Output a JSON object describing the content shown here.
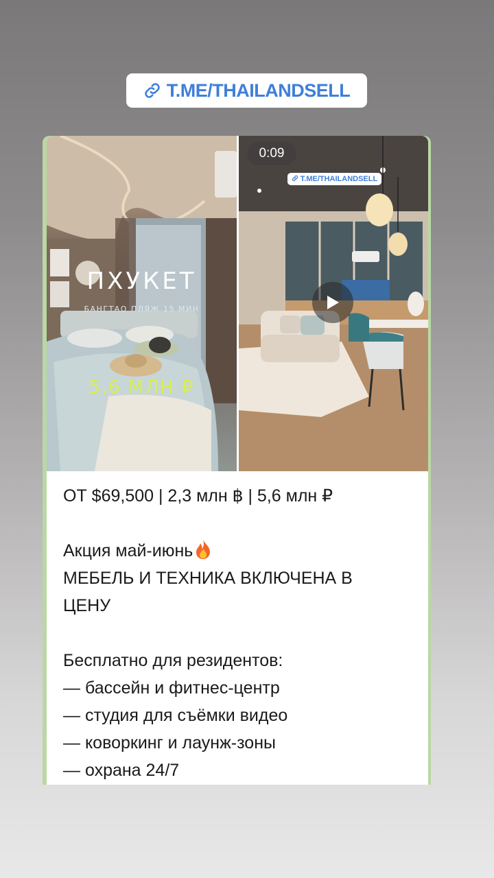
{
  "link_pill": {
    "text": "T.ME/THAILANDSELL",
    "color": "#3f7fd9",
    "icon": "link-icon"
  },
  "media": {
    "left_image": {
      "title": "ПХУКЕТ",
      "subtitle": "БАНГТАО ПЛЯЖ 15 МИН",
      "price": "5,6 МЛН ₽"
    },
    "right_video": {
      "duration": "0:09",
      "watermark": "T.ME/THAILANDSELL",
      "play_icon": "play-icon"
    }
  },
  "message": {
    "price_line": "ОТ $69,500 | 2,3 млн ฿ | 5,6 млн ₽",
    "promo": "Акция май-июнь",
    "promo_emoji": "fire-emoji",
    "furniture_line1": "МЕБЕЛЬ И ТЕХНИКА ВКЛЮЧЕНА В",
    "furniture_line2": "ЦЕНУ",
    "free_heading": "Бесплатно для резидентов:",
    "items": [
      "— бассейн и фитнес-центр",
      "— студия для съёмки видео",
      "— коворкинг и лаунж-зоны",
      "— охрана 24/7"
    ]
  },
  "colors": {
    "accent": "#d8f04a",
    "card_border": "#b9d8a4"
  }
}
